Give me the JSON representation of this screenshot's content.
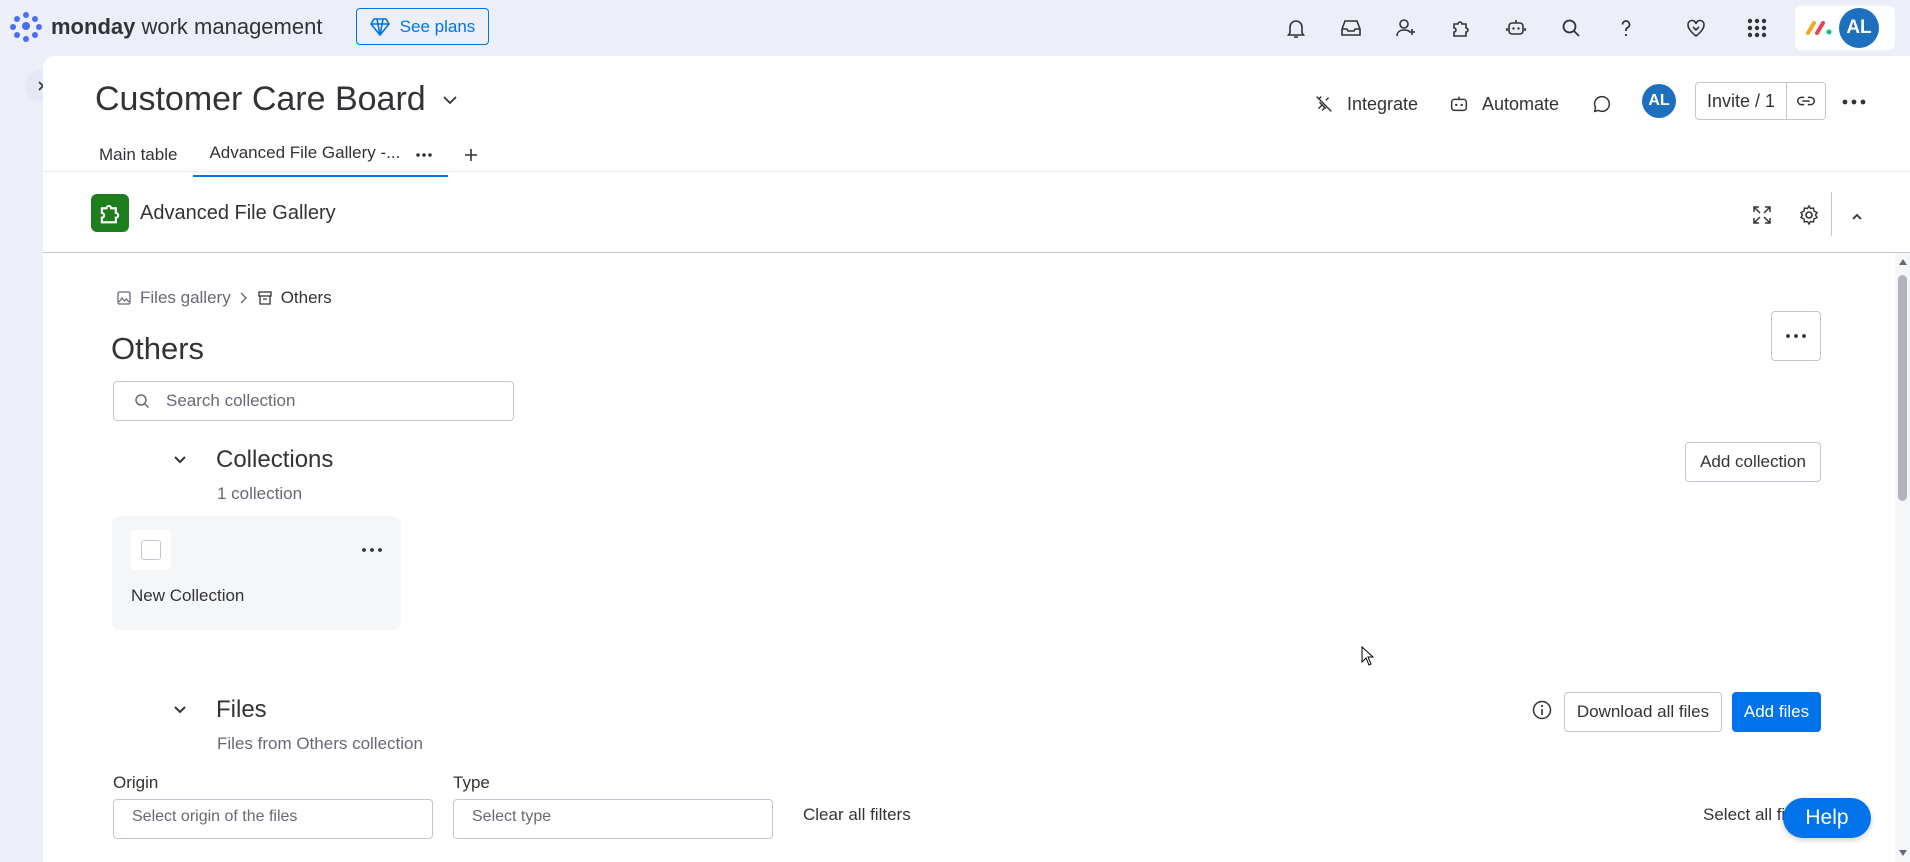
{
  "topbar": {
    "brand_bold": "monday",
    "brand_rest": " work management",
    "see_plans": "See plans",
    "avatar_initials": "AL"
  },
  "board": {
    "title": "Customer Care Board",
    "integrate": "Integrate",
    "automate": "Automate",
    "avatar_initials": "AL",
    "invite": "Invite / 1"
  },
  "tabs": [
    {
      "label": "Main table"
    },
    {
      "label": "Advanced File Gallery -..."
    }
  ],
  "widget": {
    "title": "Advanced File Gallery"
  },
  "breadcrumb": {
    "root": "Files gallery",
    "current": "Others"
  },
  "page": {
    "title": "Others",
    "search_placeholder": "Search collection"
  },
  "collections": {
    "title": "Collections",
    "subtitle": "1 collection",
    "add_button": "Add collection",
    "items": [
      {
        "name": "New Collection"
      }
    ]
  },
  "files": {
    "title": "Files",
    "subtitle": "Files from Others collection",
    "download_all": "Download all files",
    "add_files": "Add files",
    "filters": {
      "origin_label": "Origin",
      "origin_placeholder": "Select origin of the files",
      "type_label": "Type",
      "type_placeholder": "Select type",
      "clear": "Clear all filters",
      "select_all": "Select all files"
    }
  },
  "help": "Help",
  "colors": {
    "primary": "#0073ea",
    "text": "#323338",
    "muted": "#676879",
    "widget_icon_bg": "#1e7e1e"
  }
}
